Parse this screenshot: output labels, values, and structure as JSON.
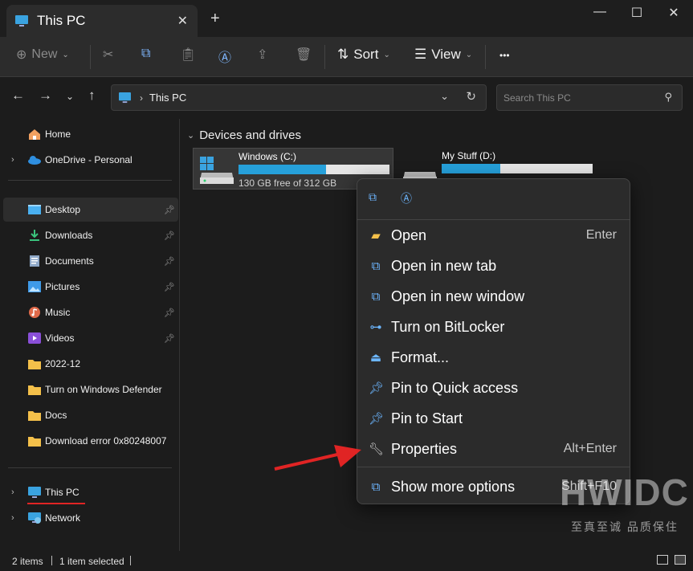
{
  "window": {
    "tab_title": "This PC",
    "close_tab": "✕",
    "new_tab": "+",
    "minimize": "—",
    "maximize": "☐",
    "close": "✕"
  },
  "toolbar": {
    "new_label": "New",
    "sort_label": "Sort",
    "view_label": "View",
    "more_label": "•••"
  },
  "address": {
    "crumb": "This PC",
    "search_placeholder": "Search This PC"
  },
  "sidebar": {
    "items": [
      {
        "label": "Home",
        "icon": "home-icon"
      },
      {
        "label": "OneDrive - Personal",
        "icon": "cloud-icon"
      },
      {
        "label": "Desktop",
        "icon": "desktop-icon",
        "pinned": true
      },
      {
        "label": "Downloads",
        "icon": "download-icon",
        "pinned": true
      },
      {
        "label": "Documents",
        "icon": "document-icon",
        "pinned": true
      },
      {
        "label": "Pictures",
        "icon": "pictures-icon",
        "pinned": true
      },
      {
        "label": "Music",
        "icon": "music-icon",
        "pinned": true
      },
      {
        "label": "Videos",
        "icon": "video-icon",
        "pinned": true
      },
      {
        "label": "2022-12",
        "icon": "folder-icon"
      },
      {
        "label": "Turn on Windows Defender",
        "icon": "folder-icon"
      },
      {
        "label": "Docs",
        "icon": "folder-icon"
      },
      {
        "label": "Download error 0x80248007",
        "icon": "folder-icon"
      },
      {
        "label": "This PC",
        "icon": "computer-icon"
      },
      {
        "label": "Network",
        "icon": "network-icon"
      }
    ]
  },
  "content": {
    "group_title": "Devices and drives",
    "drives": [
      {
        "name": "Windows (C:)",
        "free": "130 GB free of 312 GB",
        "used_fraction": 0.58
      },
      {
        "name": "My Stuff (D:)",
        "free": "",
        "used_fraction": 0.39
      }
    ]
  },
  "context_menu": {
    "items": [
      {
        "label": "Open",
        "shortcut": "Enter",
        "icon": "folder-open-icon"
      },
      {
        "label": "Open in new tab",
        "shortcut": "",
        "icon": "new-tab-icon"
      },
      {
        "label": "Open in new window",
        "shortcut": "",
        "icon": "new-window-icon"
      },
      {
        "label": "Turn on BitLocker",
        "shortcut": "",
        "icon": "bitlocker-icon"
      },
      {
        "label": "Format...",
        "shortcut": "",
        "icon": "format-icon"
      },
      {
        "label": "Pin to Quick access",
        "shortcut": "",
        "icon": "pin-icon"
      },
      {
        "label": "Pin to Start",
        "shortcut": "",
        "icon": "pin-start-icon"
      },
      {
        "label": "Properties",
        "shortcut": "Alt+Enter",
        "icon": "wrench-icon"
      },
      {
        "label": "Show more options",
        "shortcut": "Shift+F10",
        "icon": "more-options-icon"
      }
    ]
  },
  "status": {
    "items_count": "2 items",
    "selected": "1 item selected"
  },
  "watermark": {
    "brand": "HWIDC",
    "tagline": "至真至诚 品质保住"
  },
  "colors": {
    "accent": "#26a0da",
    "icon_blue": "#6cb6ff",
    "annotation_red": "#e02424"
  }
}
